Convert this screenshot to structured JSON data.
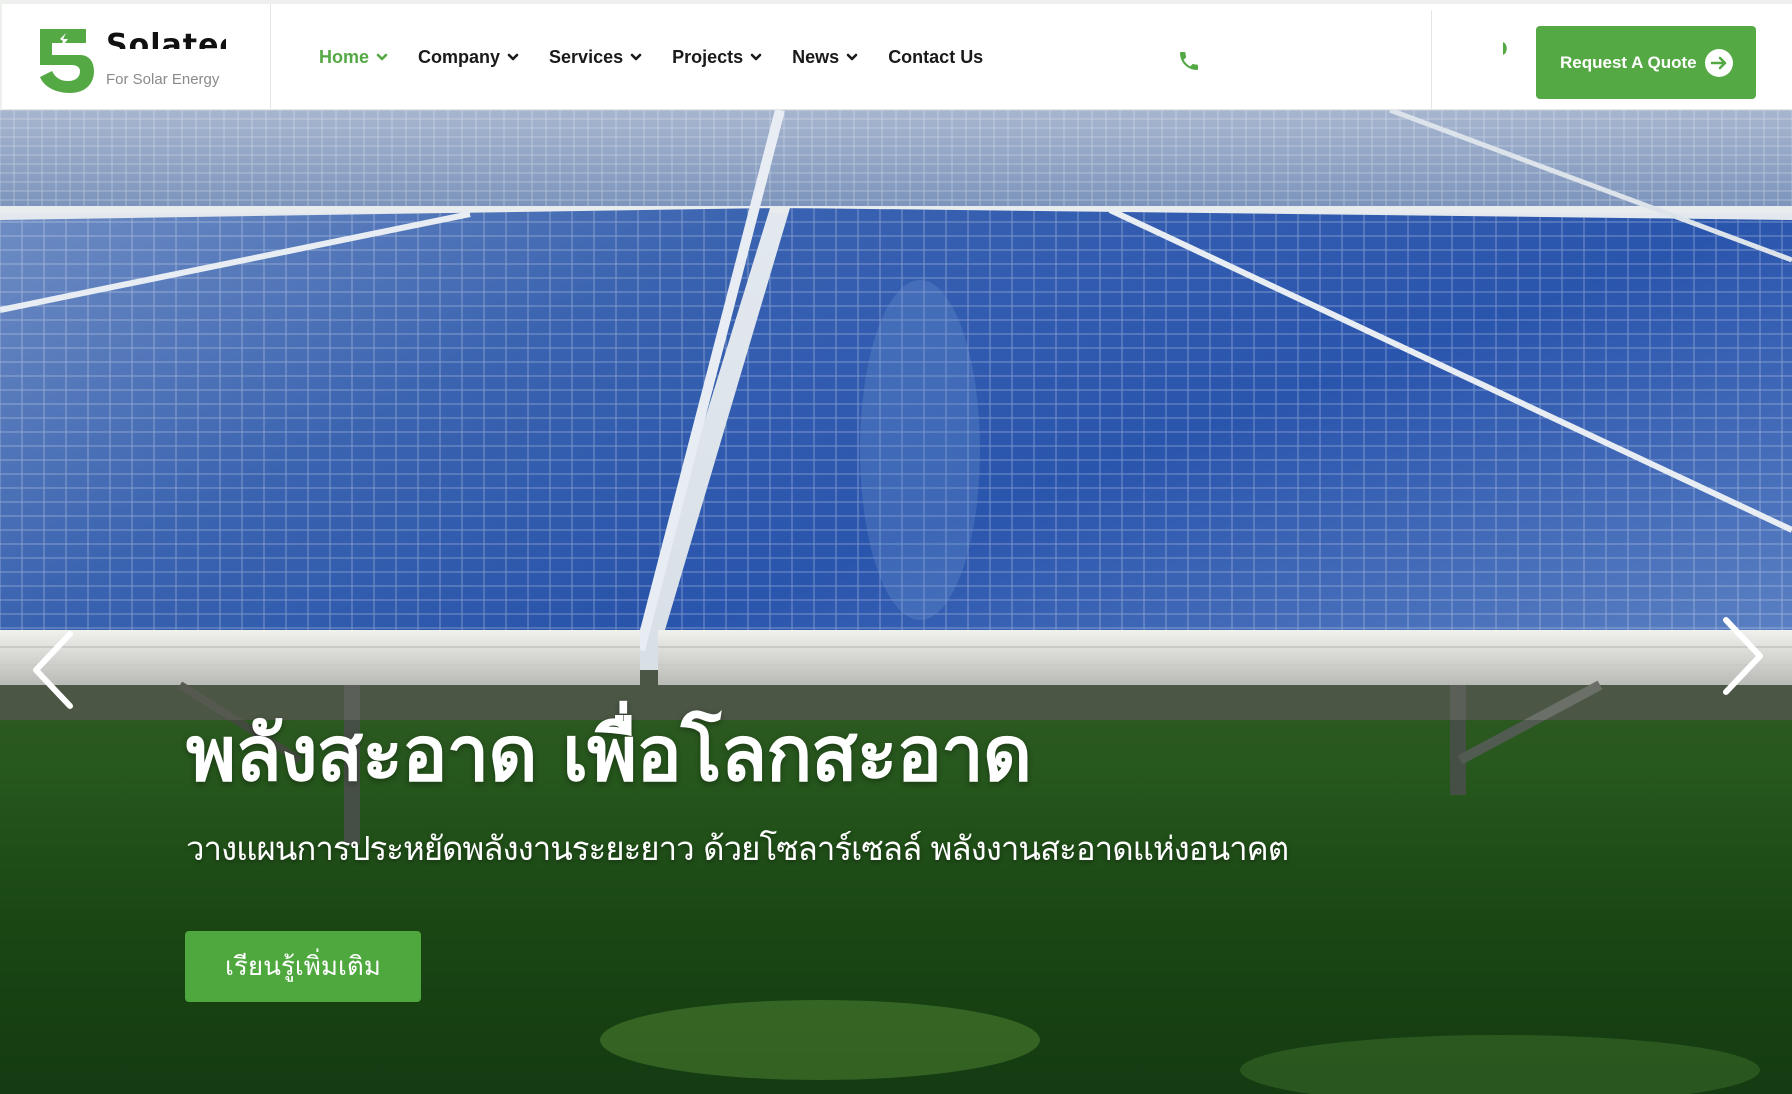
{
  "brand": {
    "name": "Solatec",
    "tagline": "For Solar Energy",
    "logo_icon": "solar-shield-logo",
    "accent_color": "#55a944"
  },
  "nav": {
    "items": [
      {
        "label": "Home",
        "active": true,
        "has_dropdown": true
      },
      {
        "label": "Company",
        "active": false,
        "has_dropdown": true
      },
      {
        "label": "Services",
        "active": false,
        "has_dropdown": true
      },
      {
        "label": "Projects",
        "active": false,
        "has_dropdown": true
      },
      {
        "label": "News",
        "active": false,
        "has_dropdown": true
      },
      {
        "label": "Contact Us",
        "active": false,
        "has_dropdown": false
      }
    ]
  },
  "header": {
    "phone_icon": "phone-icon",
    "quote_button": {
      "label": "Request A Quote",
      "icon": "arrow-right-circle-icon"
    }
  },
  "hero": {
    "title": "พลังสะอาด เพื่อโลกสะอาด",
    "subtitle": "วางแผนการประหยัดพลังงานระยะยาว ด้วยโซลาร์เซลล์ พลังงานสะอาดแห่งอนาคต",
    "cta_label": "เรียนรู้เพิ่มเติม",
    "cta_color": "#4ea83e",
    "prev_icon": "chevron-left-icon",
    "next_icon": "chevron-right-icon"
  }
}
